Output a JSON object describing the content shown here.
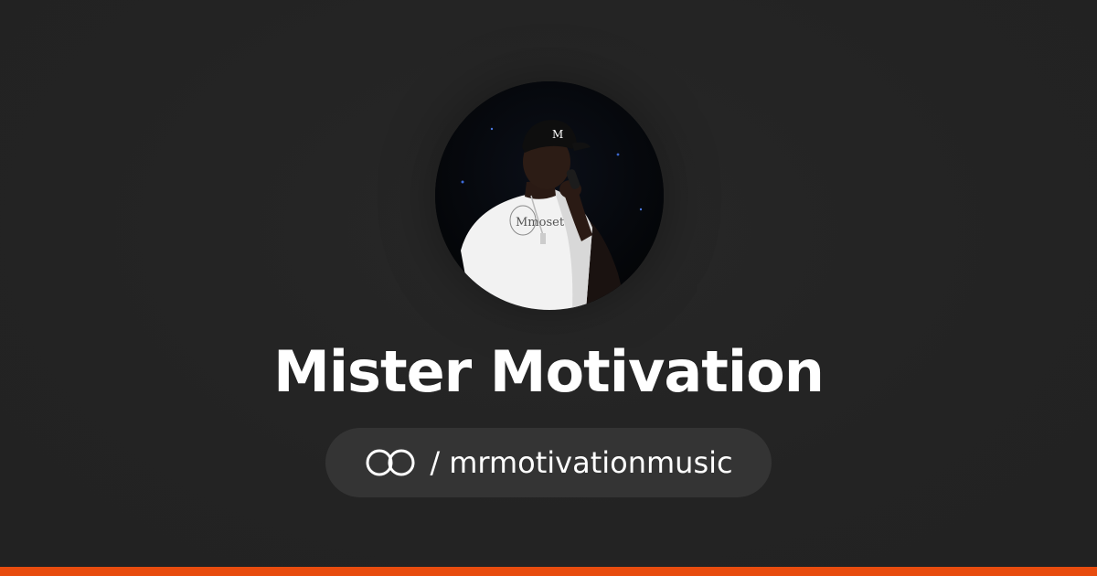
{
  "profile": {
    "name": "Mister Motivation",
    "separator": "/",
    "handle": "mrmotivationmusic",
    "avatar_alt": "profile-photo",
    "shirt_text": "Mmoset"
  },
  "colors": {
    "background": "#232323",
    "pill_background": "#343434",
    "accent": "#e84c0e",
    "text": "#ffffff"
  },
  "icons": {
    "brand": "interlocked-rings-icon"
  }
}
